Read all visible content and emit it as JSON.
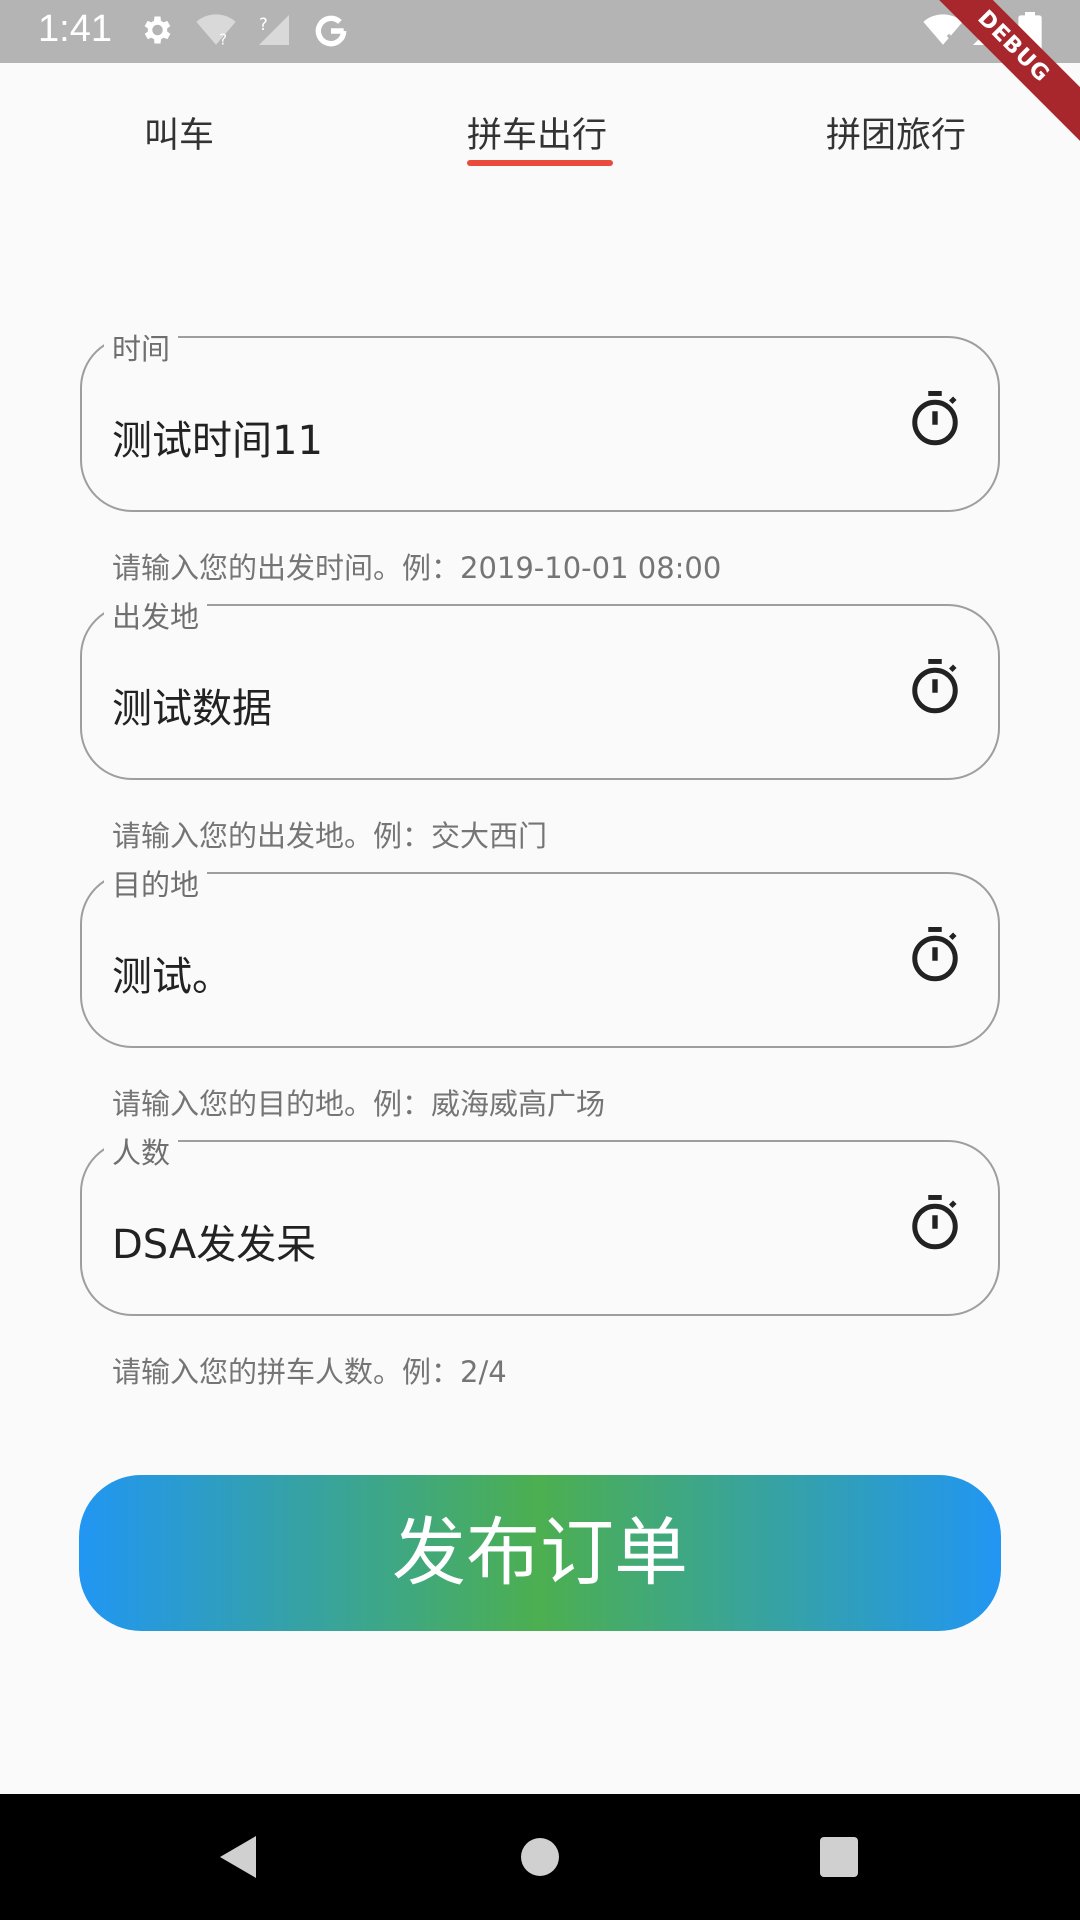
{
  "status_bar": {
    "time": "1:41",
    "icons": [
      "settings-icon",
      "wifi-unknown-icon",
      "signal-unknown-icon",
      "google-icon",
      "wifi-x-icon",
      "signal-icon",
      "battery-icon"
    ]
  },
  "debug_banner": "DEBUG",
  "tabs": [
    {
      "label": "叫车",
      "selected": false
    },
    {
      "label": "拼车出行",
      "selected": true
    },
    {
      "label": "拼团旅行",
      "selected": false
    }
  ],
  "accent_color": "#e94b3c",
  "form": {
    "fields": [
      {
        "label": "时间",
        "value": "测试时间11",
        "helper": "请输入您的出发时间。例：2019-10-01 08:00",
        "icon": "timer-icon"
      },
      {
        "label": "出发地",
        "value": "测试数据",
        "helper": "请输入您的出发地。例：交大西门",
        "icon": "timer-icon"
      },
      {
        "label": "目的地",
        "value": "测试。",
        "helper": "请输入您的目的地。例：威海威高广场",
        "icon": "timer-icon"
      },
      {
        "label": "人数",
        "value": "DSA发发呆",
        "helper": "请输入您的拼车人数。例：2/4",
        "icon": "timer-icon"
      }
    ]
  },
  "submit_button": {
    "label": "发布订单",
    "gradient_colors": [
      "#2196f3",
      "#4caf50",
      "#2196f3"
    ]
  },
  "nav_bar": {
    "icons": [
      "back-icon",
      "home-icon",
      "recents-icon"
    ]
  }
}
